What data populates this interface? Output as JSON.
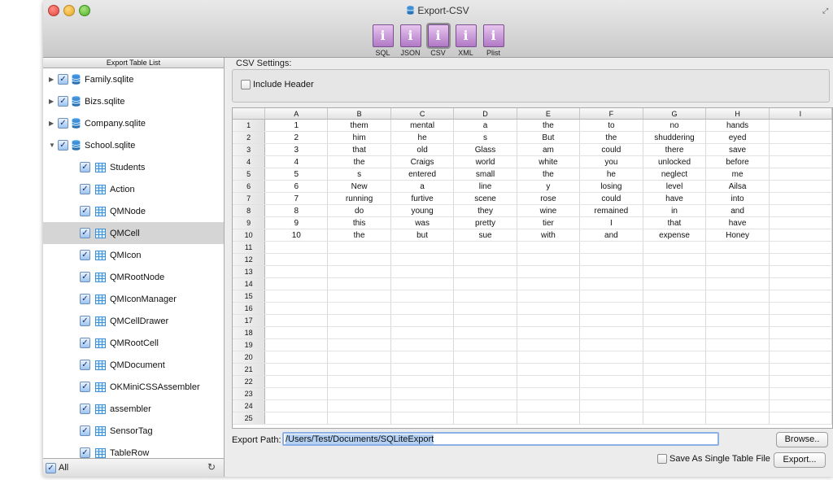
{
  "window": {
    "title": "Export-CSV"
  },
  "toolbar": {
    "items": [
      {
        "label": "SQL",
        "glyph": "i"
      },
      {
        "label": "JSON",
        "glyph": "i"
      },
      {
        "label": "CSV",
        "glyph": "i"
      },
      {
        "label": "XML",
        "glyph": "i"
      },
      {
        "label": "Plist",
        "glyph": "i"
      }
    ],
    "active": "CSV"
  },
  "sidebar": {
    "header": "Export Table List",
    "databases": [
      {
        "label": "Family.sqlite",
        "expanded": false
      },
      {
        "label": "Bizs.sqlite",
        "expanded": false
      },
      {
        "label": "Company.sqlite",
        "expanded": false
      },
      {
        "label": "School.sqlite",
        "expanded": true
      }
    ],
    "tables": [
      "Students",
      "Action",
      "QMNode",
      "QMCell",
      "QMIcon",
      "QMRootNode",
      "QMIconManager",
      "QMCellDrawer",
      "QMRootCell",
      "QMDocument",
      "OKMiniCSSAssembler",
      "assembler",
      "SensorTag",
      "TableRow"
    ],
    "selected_table": "QMCell",
    "footer": {
      "all_label": "All",
      "refresh_icon": "refresh-icon"
    }
  },
  "csv_settings": {
    "title": "CSV Settings:",
    "include_header_label": "Include Header",
    "include_header_checked": false
  },
  "grid": {
    "columns": [
      "A",
      "B",
      "C",
      "D",
      "E",
      "F",
      "G",
      "H",
      "I"
    ],
    "rows": [
      [
        "1",
        "them",
        "mental",
        "a",
        "the",
        "to",
        "no",
        "hands",
        ""
      ],
      [
        "2",
        "him",
        "he",
        "s",
        "But",
        "the",
        "shuddering",
        "eyed",
        ""
      ],
      [
        "3",
        "that",
        "old",
        "Glass",
        "am",
        "could",
        "there",
        "save",
        ""
      ],
      [
        "4",
        "the",
        "Craigs",
        "world",
        "white",
        "you",
        "unlocked",
        "before",
        ""
      ],
      [
        "5",
        "s",
        "entered",
        "small",
        "the",
        "he",
        "neglect",
        "me",
        ""
      ],
      [
        "6",
        "New",
        "a",
        "line",
        "y",
        "losing",
        "level",
        "Ailsa",
        ""
      ],
      [
        "7",
        "running",
        "furtive",
        "scene",
        "rose",
        "could",
        "have",
        "into",
        ""
      ],
      [
        "8",
        "do",
        "young",
        "they",
        "wine",
        "remained",
        "in",
        "and",
        ""
      ],
      [
        "9",
        "this",
        "was",
        "pretty",
        "tier",
        "I",
        "that",
        "have",
        ""
      ],
      [
        "10",
        "the",
        "but",
        "sue",
        "with",
        "and",
        "expense",
        "Honey",
        ""
      ]
    ],
    "row_count": 25
  },
  "export_path": {
    "label": "Export Path:",
    "value": "/Users/Test/Documents/SQLiteExport",
    "browse_label": "Browse.."
  },
  "save_single": {
    "label": "Save As Single Table File",
    "checked": false
  },
  "export_button": "Export...",
  "colors": {
    "db_icon": "#3c8fd8",
    "table_icon": "#3c8fd8",
    "format_icon": "#c28ad4"
  }
}
